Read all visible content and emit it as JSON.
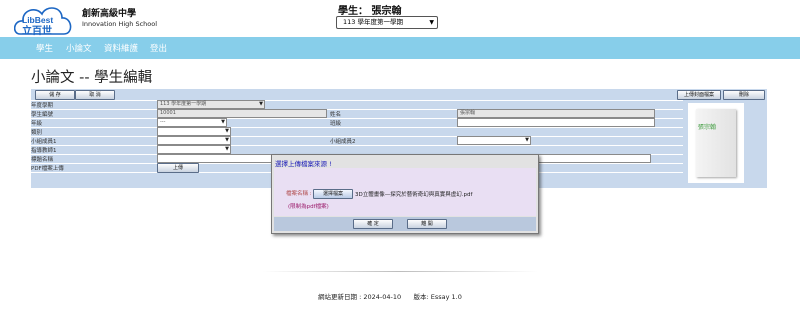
{
  "header": {
    "logo_text_latin": "LibBest",
    "logo_text_cjk": "立百世",
    "school_name": "創新高級中學",
    "school_name_en": "Innovation High School",
    "student_label": "學生： 張宗翰",
    "semester_value": "113 學年度第一學期"
  },
  "nav": {
    "items": [
      "學生",
      "小論文",
      "資料維護",
      "登出"
    ]
  },
  "page": {
    "title": "小論文 -- 學生編輯"
  },
  "toolbar": {
    "save_label": "儲 存",
    "cancel_label": "取 消",
    "upload_cover_label": "上傳封面檔案",
    "delete_label": "刪除"
  },
  "form": {
    "labels": {
      "school_year": "年度學期",
      "student_id": "學生編號",
      "grade": "年級",
      "category": "類別",
      "member1": "小組成員1",
      "member2": "小組成員2",
      "advisor1": "指導教師1",
      "title": "標題名稱",
      "pdf_upload": "PDF檔案上傳",
      "name": "姓名",
      "class": "班級"
    },
    "values": {
      "school_year": "113 學年度第一學期",
      "student_id": "10001",
      "grade": "---",
      "name": "張宗翰"
    },
    "upload_button": "上傳"
  },
  "dialog": {
    "title": "選擇上傳檔案來源 !",
    "file_label": "檔案名稱 :",
    "choose_button": "選擇檔案",
    "chosen_file": "3D立體畫像—探究於藝術奇幻與真實與虛幻.pdf",
    "limit_note": "(限制為pdf檔案)",
    "confirm_label": "確 定",
    "cancel_label": "離 開"
  },
  "preview": {
    "name": "張宗翰"
  },
  "footer": {
    "text": "網站更新日期 : 2024-04-10      版本: Essay 1.0"
  },
  "colors": {
    "nav_bg": "#87ceea",
    "panel_bg": "#c8d8ec",
    "dialog_title": "#1a1ab8",
    "limit_note": "#9b1b6b",
    "preview_text": "#3a9a3a"
  }
}
